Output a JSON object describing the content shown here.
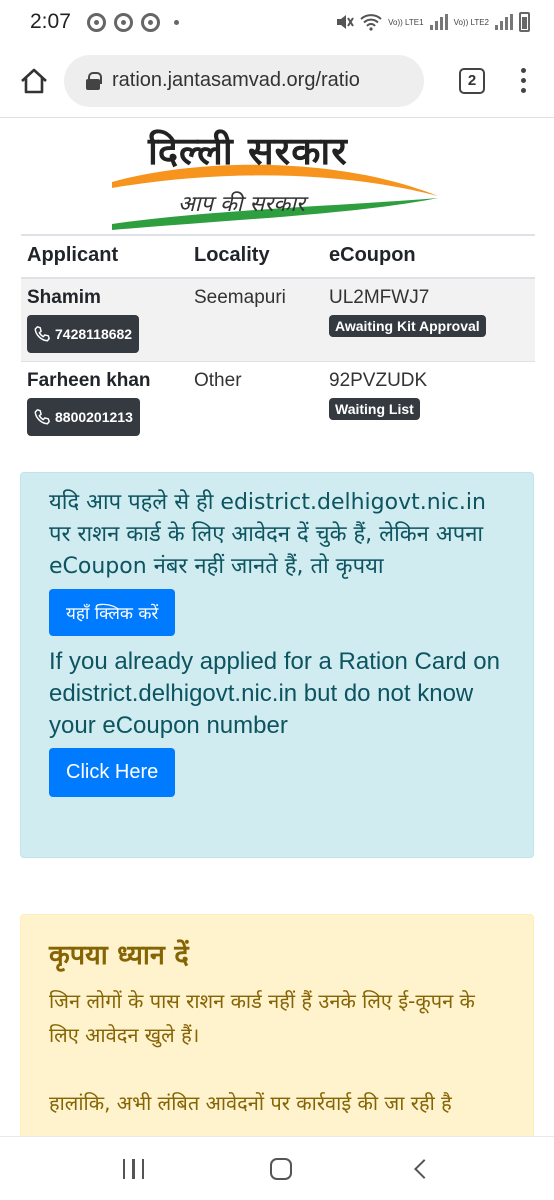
{
  "status_bar": {
    "time": "2:07",
    "lte1": "Vo)) LTE1",
    "lte2": "Vo)) LTE2"
  },
  "browser": {
    "url": "ration.jantasamvad.org/ratio",
    "tab_count": "2"
  },
  "logo": {
    "title": "दिल्ली सरकार",
    "subtitle": "आप की सरकार",
    "colors": {
      "saffron": "#f7941d",
      "green": "#2e9e3f"
    }
  },
  "table": {
    "headers": [
      "Applicant",
      "Locality",
      "eCoupon"
    ],
    "rows": [
      {
        "name": "Shamim",
        "phone": "7428118682",
        "locality": "Seemapuri",
        "coupon": "UL2MFWJ7",
        "status": "Awaiting Kit Approval"
      },
      {
        "name": "Farheen khan",
        "phone": "8800201213",
        "locality": "Other",
        "coupon": "92PVZUDK",
        "status": "Waiting List"
      }
    ]
  },
  "info": {
    "hindi_text": "यदि आप पहले से ही edistrict.delhigovt.nic.in पर राशन कार्ड के लिए आवेदन दें चुके हैं, लेकिन अपना eCoupon नंबर नहीं जानते हैं, तो कृपया",
    "hindi_button": "यहाँ क्लिक करें",
    "english_text": "If you already applied for a Ration Card on edistrict.delhigovt.nic.in but do not know your eCoupon number",
    "english_button": "Click Here"
  },
  "notice": {
    "title": "कृपया ध्यान दें",
    "para1": "जिन लोगों के पास राशन कार्ड नहीं हैं उनके लिए ई-कूपन के लिए आवेदन खुले हैं।",
    "para2": "हालांकि, अभी लंबित आवेदनों पर कार्रवाई की जा रही है"
  }
}
